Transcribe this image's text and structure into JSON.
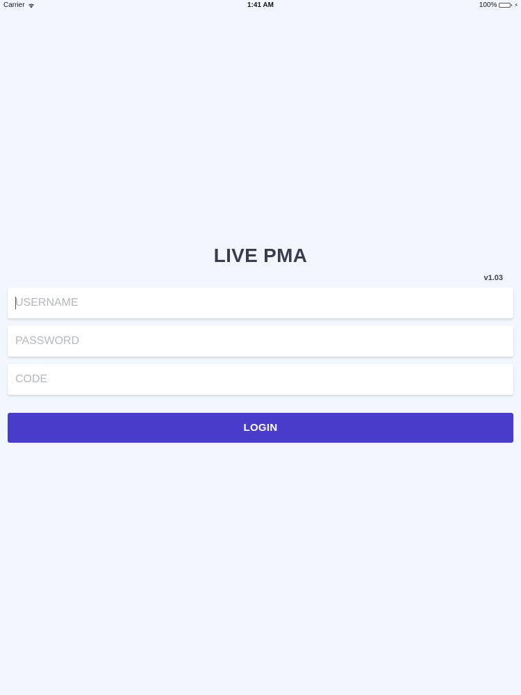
{
  "status_bar": {
    "carrier": "Carrier",
    "time": "1:41 AM",
    "battery": "100%",
    "icons": [
      "wifi-icon",
      "battery-icon",
      "charging-icon"
    ]
  },
  "app": {
    "title": "LIVE PMA",
    "version": "v1.03"
  },
  "form": {
    "username": {
      "placeholder": "USERNAME",
      "value": ""
    },
    "password": {
      "placeholder": "PASSWORD",
      "value": ""
    },
    "code": {
      "placeholder": "CODE",
      "value": ""
    },
    "login_label": "LOGIN"
  },
  "colors": {
    "background": "#f2f7ff",
    "title": "#3a3d4d",
    "button": "#4a3ccb",
    "button_text": "#ffffff",
    "placeholder": "#b4b7be",
    "battery": "#4cd964"
  }
}
